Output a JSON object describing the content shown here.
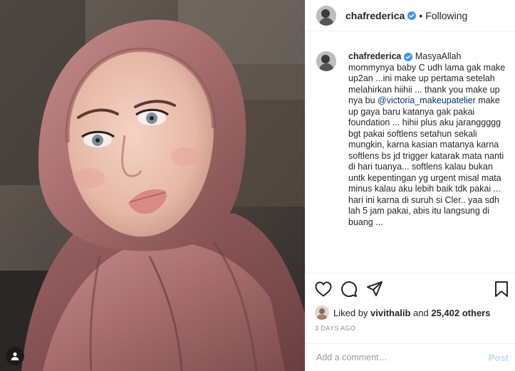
{
  "post": {
    "username": "chafrederica",
    "verified": true,
    "follow_status": "Following",
    "header_separator": "•"
  },
  "caption": {
    "username": "chafrederica",
    "text_before_mention": "MasyaAllah mommynya baby C udh lama gak make up2an ...ini make up pertama setelah melahirkan hiihii ... thank you make up nya bu",
    "mention": "@victoria_makeupatelier",
    "text_after_mention": " make up gaya baru katanya gak pakai foundation ... hihii plus aku jaranggggg bgt pakai softlens setahun sekali mungkin, karna kasian matanya karna softlens bs jd trigger katarak mata nanti di hari tuanya... softlens kalau bukan untk kepentingan yg urgent misal mata minus kalau aku lebih baik tdk pakai ... hari ini karna di suruh si Cler.. yaa sdh lah 5 jam pakai, abis itu langsung di buang ..."
  },
  "likes": {
    "prefix": "Liked by",
    "first_liker": "vivithalib",
    "joiner": "and",
    "others": "25,402 others"
  },
  "timestamp": "3 DAYS AGO",
  "comment_box": {
    "placeholder": "Add a comment…",
    "post_label": "Post"
  },
  "icons": {
    "like": "heart-icon",
    "comment": "comment-icon",
    "share": "paper-plane-icon",
    "save": "bookmark-icon",
    "photo_user_tag": "user-tag-icon",
    "verified": "verified-badge-icon"
  },
  "colors": {
    "verified_blue": "#3897f0",
    "mention": "#00376b",
    "post_button_disabled": "#b2dffc",
    "muted_text": "#8e8e8e"
  }
}
